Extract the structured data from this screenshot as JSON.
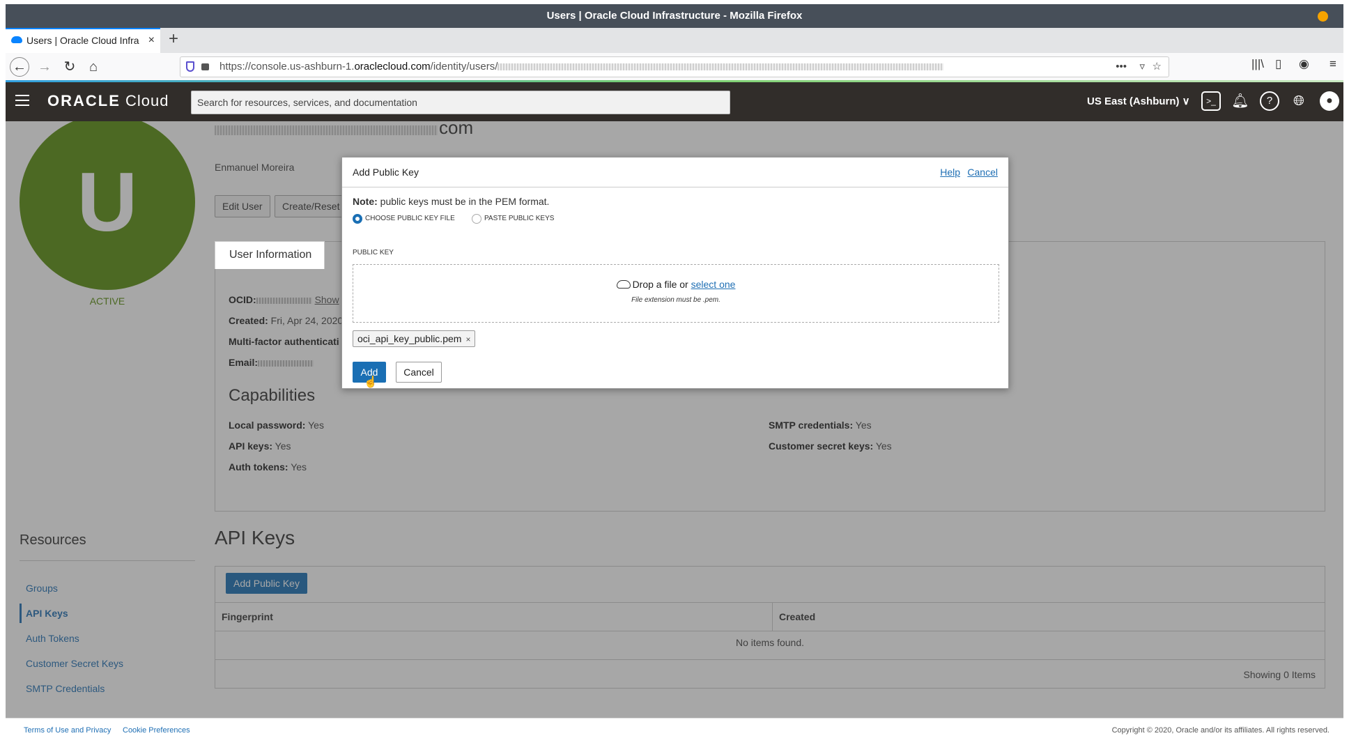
{
  "browser": {
    "window_title": "Users | Oracle Cloud Infrastructure - Mozilla Firefox",
    "tab_title": "Users | Oracle Cloud Infra",
    "url_prefix": "https://console.us-ashburn-1.",
    "url_domain": "oraclecloud.com",
    "url_path": "/identity/users/"
  },
  "header": {
    "brand_bold": "ORACLE",
    "brand_rest": " Cloud",
    "search_placeholder": "Search for resources, services, and documentation",
    "region": "US East (Ashburn) ∨"
  },
  "user": {
    "email_suffix": "com",
    "name": "Enmanuel Moreira",
    "avatar_letter": "U",
    "status": "ACTIVE",
    "edit_button": "Edit User",
    "reset_button": "Create/Reset"
  },
  "info_tab": "User Information",
  "info": {
    "ocid_label": "OCID:",
    "ocid_show": "Show",
    "created_label": "Created:",
    "created_value": " Fri, Apr 24, 2020",
    "mfa_label": "Multi-factor authenticati",
    "email_label": "Email:"
  },
  "capabilities": {
    "heading": "Capabilities",
    "local_password_label": "Local password:",
    "local_password_value": " Yes",
    "api_keys_label": "API keys:",
    "api_keys_value": " Yes",
    "auth_tokens_label": "Auth tokens:",
    "auth_tokens_value": " Yes",
    "smtp_label": "SMTP credentials:",
    "smtp_value": " Yes",
    "csk_label": "Customer secret keys:",
    "csk_value": " Yes"
  },
  "resources": {
    "heading": "Resources",
    "items": [
      "Groups",
      "API Keys",
      "Auth Tokens",
      "Customer Secret Keys",
      "SMTP Credentials"
    ]
  },
  "api_keys": {
    "heading": "API Keys",
    "add_button": "Add Public Key",
    "col_fingerprint": "Fingerprint",
    "col_created": "Created",
    "empty": "No items found.",
    "showing": "Showing 0 Items"
  },
  "footer": {
    "terms": "Terms of Use and Privacy",
    "cookies": "Cookie Preferences",
    "copyright": "Copyright © 2020, Oracle and/or its affiliates. All rights reserved."
  },
  "modal": {
    "title": "Add Public Key",
    "help": "Help",
    "cancel_link": "Cancel",
    "note_bold": "Note:",
    "note_text": " public keys must be in the PEM format.",
    "radio_file": "CHOOSE PUBLIC KEY FILE",
    "radio_paste": "PASTE PUBLIC KEYS",
    "public_key_label": "PUBLIC KEY",
    "drop_text": "Drop a file or ",
    "select_one": "select one",
    "extension_hint": "File extension must be .pem.",
    "file_chip": "oci_api_key_public.pem",
    "add_button": "Add",
    "cancel_button": "Cancel"
  },
  "colors": {
    "oci_header": "#312d2a",
    "primary": "#1a6fb4",
    "avatar": "#5a8e10"
  }
}
